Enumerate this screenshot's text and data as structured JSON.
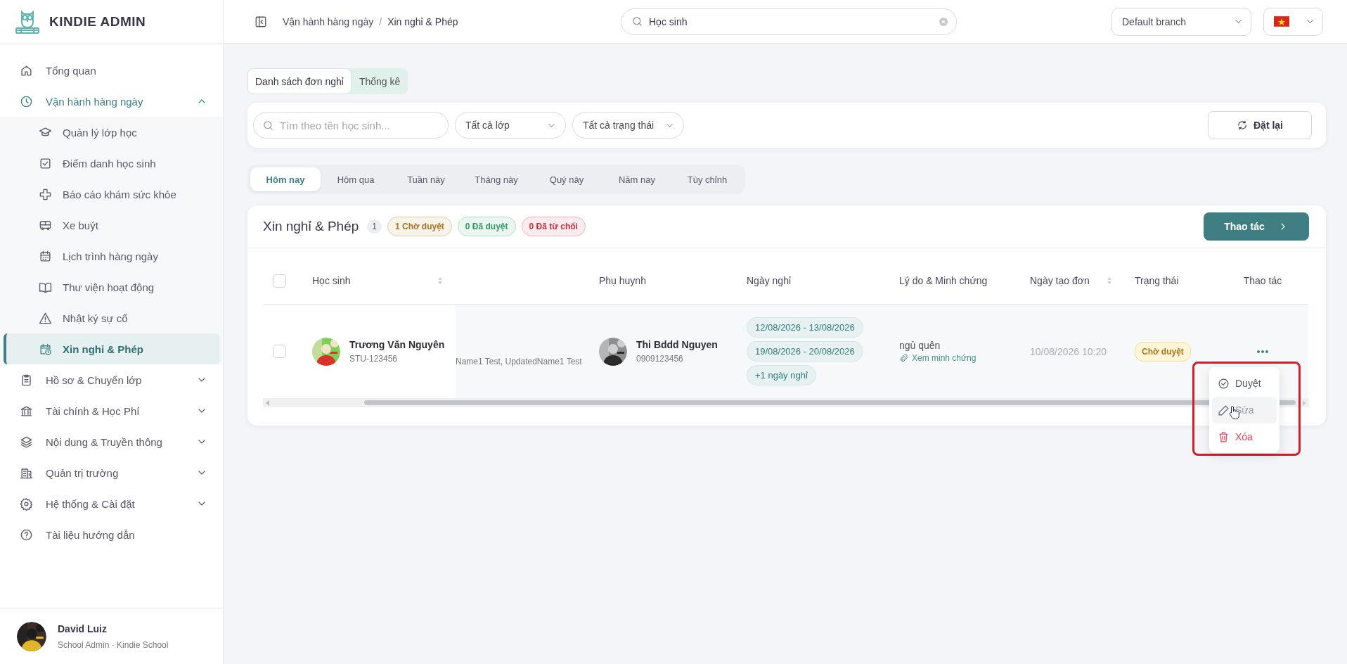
{
  "brand": {
    "name": "KINDIE ADMIN"
  },
  "sidebar": {
    "items": [
      {
        "kind": "link",
        "label": "Tổng quan",
        "selected": false
      },
      {
        "kind": "group",
        "label": "Vận hành hàng ngày",
        "selected": false,
        "expanded": true,
        "children": [
          {
            "label": "Quản lý lớp học",
            "selected": false
          },
          {
            "label": "Điểm danh học sinh",
            "selected": false
          },
          {
            "label": "Báo cáo khám sức khỏe",
            "selected": false
          },
          {
            "label": "Xe buýt",
            "selected": false
          },
          {
            "label": "Lịch trình hàng ngày",
            "selected": false
          },
          {
            "label": "Thư viện hoạt động",
            "selected": false
          },
          {
            "label": "Nhật ký sự cố",
            "selected": false
          },
          {
            "label": "Xin nghỉ & Phép",
            "selected": true
          }
        ]
      },
      {
        "kind": "group",
        "label": "Hồ sơ & Chuyển lớp",
        "selected": false,
        "expanded": false
      },
      {
        "kind": "group",
        "label": "Tài chính & Học Phí",
        "selected": false,
        "expanded": false
      },
      {
        "kind": "group",
        "label": "Nội dung & Truyền thông",
        "selected": false,
        "expanded": false
      },
      {
        "kind": "group",
        "label": "Quản trị trường",
        "selected": false,
        "expanded": false
      },
      {
        "kind": "group",
        "label": "Hệ thống & Cài đặt",
        "selected": false,
        "expanded": false
      },
      {
        "kind": "link",
        "label": "Tài liệu hướng dẫn",
        "selected": false
      }
    ]
  },
  "user": {
    "name": "David Luiz",
    "role": "School Admin · Kindie School"
  },
  "header": {
    "breadcrumb": [
      "Vận hành hàng ngày",
      "Xin nghỉ & Phép"
    ],
    "breadcrumb_separator": "/",
    "search": {
      "value": "Học sinh"
    },
    "branch_select": {
      "value": "Default branch"
    }
  },
  "view_tabs": [
    {
      "label": "Danh sách đơn nghỉ",
      "selected": true
    },
    {
      "label": "Thống kê",
      "selected": false
    }
  ],
  "filters": {
    "search": {
      "placeholder": "Tìm theo tên học sinh..."
    },
    "class_select": {
      "value": "Tất cả lớp"
    },
    "status_select": {
      "value": "Tất cả trạng thái"
    },
    "reset_button": "Đặt lại"
  },
  "period_tabs": [
    {
      "label": "Hôm nay",
      "selected": true
    },
    {
      "label": "Hôm qua",
      "selected": false
    },
    {
      "label": "Tuần này",
      "selected": false
    },
    {
      "label": "Tháng này",
      "selected": false
    },
    {
      "label": "Quý này",
      "selected": false
    },
    {
      "label": "Năm nay",
      "selected": false
    },
    {
      "label": "Tùy chỉnh",
      "selected": false
    }
  ],
  "panel": {
    "title": "Xin nghỉ & Phép",
    "count": "1",
    "badges": [
      {
        "label": "1 Chờ duyệt",
        "color": "#a8741a"
      },
      {
        "label": "0 Đã duyệt",
        "color": "#2e9a62"
      },
      {
        "label": "0 Đã từ chối",
        "color": "#c23140"
      }
    ],
    "action_button": "Thao tác"
  },
  "table": {
    "select_all": {
      "checked": false
    },
    "columns": [
      {
        "label": "Học sinh",
        "sortable": true
      },
      {
        "sortable": false
      },
      {
        "label": "Phụ huynh",
        "sortable": false
      },
      {
        "label": "Ngày nghỉ",
        "sortable": false
      },
      {
        "label": "Lý do & Minh chứng",
        "sortable": false
      },
      {
        "label": "Ngày tạo đơn",
        "sortable": true
      },
      {
        "label": "Trạng thái",
        "sortable": false
      },
      {
        "label": "Thao tác",
        "sortable": false
      }
    ],
    "rows": [
      {
        "checked": false,
        "student": {
          "name": "Trương Văn Nguyên",
          "code": "STU-123456"
        },
        "column_2": "Name1 Test, UpdatedName1 Test",
        "parent": {
          "name": "Thi Bddd Nguyen",
          "phone": "0909123456"
        },
        "leave_days": [
          "12/08/2026 - 13/08/2026",
          "19/08/2026 - 20/08/2026",
          "+1 ngày nghỉ"
        ],
        "reason": "ngủ quên",
        "evidence_link": "Xem minh chứng",
        "created_at": "10/08/2026 10:20",
        "status": {
          "label": "Chờ duyệt",
          "kind": "pending"
        }
      }
    ]
  },
  "context_menu": {
    "items": [
      {
        "kind": "approve",
        "label": "Duyệt",
        "hovered": false
      },
      {
        "kind": "edit",
        "label": "Sửa",
        "hovered": true
      },
      {
        "kind": "delete",
        "label": "Xóa",
        "hovered": false
      }
    ]
  }
}
